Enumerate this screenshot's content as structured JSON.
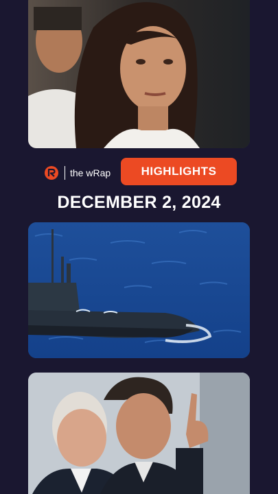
{
  "brand": {
    "logo_icon": "rappler-logo-icon",
    "show_name": "the wRap"
  },
  "badge": {
    "label": "HIGHLIGHTS",
    "color": "#ec4a23"
  },
  "date": "DECEMBER 2, 2024",
  "photos": [
    {
      "subject": "woman-portrait-photo"
    },
    {
      "subject": "submarine-at-sea-photo"
    },
    {
      "subject": "two-men-in-suits-photo"
    }
  ],
  "colors": {
    "background": "#1a1730",
    "accent": "#ec4a23"
  }
}
